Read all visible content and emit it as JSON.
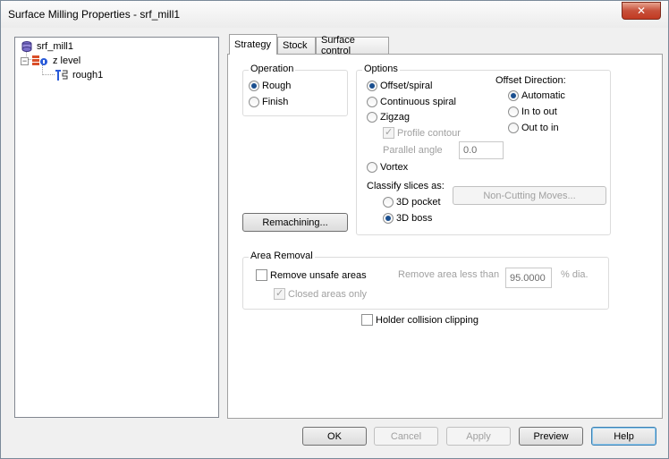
{
  "window": {
    "title": "Surface Milling Properties - srf_mill1",
    "close_glyph": "✕"
  },
  "tree": {
    "root": "srf_mill1",
    "child": "z level",
    "grandchild": "rough1",
    "expander_glyph": "−"
  },
  "tabs": [
    {
      "label": "Strategy",
      "active": true
    },
    {
      "label": "Stock",
      "active": false
    },
    {
      "label": "Surface control",
      "active": false
    }
  ],
  "operation": {
    "title": "Operation",
    "rough": "Rough",
    "finish": "Finish",
    "selected": "Rough"
  },
  "options": {
    "title": "Options",
    "offset_spiral": "Offset/spiral",
    "continuous_spiral": "Continuous spiral",
    "zigzag": "Zigzag",
    "profile_contour": "Profile contour",
    "parallel_angle_label": "Parallel angle",
    "parallel_angle_value": "0.0",
    "vortex": "Vortex",
    "classify_label": "Classify slices as:",
    "pocket_3d": "3D pocket",
    "boss_3d": "3D boss",
    "non_cutting": "Non-Cutting Moves...",
    "selected_strategy": "Offset/spiral",
    "selected_classify": "3D boss"
  },
  "offset_direction": {
    "title": "Offset Direction:",
    "automatic": "Automatic",
    "in_to_out": "In to out",
    "out_to_in": "Out to in",
    "selected": "Automatic"
  },
  "remachining_label": "Remachining...",
  "area_removal": {
    "title": "Area Removal",
    "remove_unsafe": "Remove unsafe areas",
    "closed_only": "Closed areas only",
    "less_than_label": "Remove area less than",
    "less_than_value": "95.0000",
    "unit": "% dia."
  },
  "holder_collision": "Holder collision clipping",
  "buttons": {
    "ok": "OK",
    "cancel": "Cancel",
    "apply": "Apply",
    "preview": "Preview",
    "help": "Help"
  },
  "colors": {
    "accent": "#1a4f8f",
    "close": "#c7503a"
  }
}
